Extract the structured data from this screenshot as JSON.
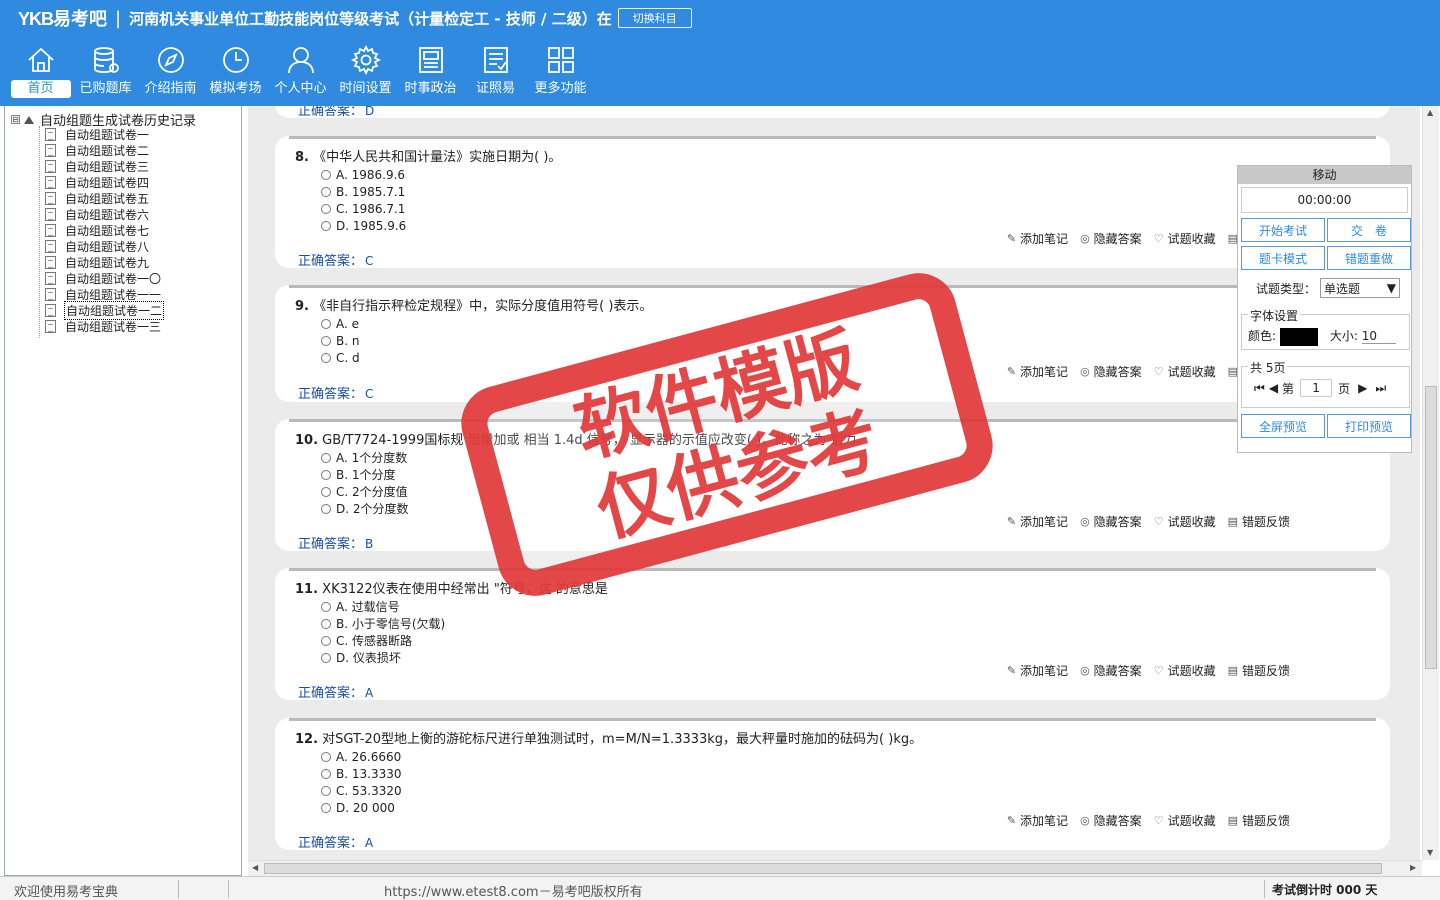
{
  "header": {
    "logo_prefix": "YKB",
    "logo_suffix": "易考吧",
    "separator": "|",
    "exam_title": "河南机关事业单位工勤技能岗位等级考试（计量检定工 - 技师 / 二级）在",
    "switch_label": "切换科目"
  },
  "nav": [
    {
      "label": "首页",
      "icon": "home-icon"
    },
    {
      "label": "已购题库",
      "icon": "database-icon"
    },
    {
      "label": "介绍指南",
      "icon": "compass-icon"
    },
    {
      "label": "模拟考场",
      "icon": "clock-icon"
    },
    {
      "label": "个人中心",
      "icon": "user-icon"
    },
    {
      "label": "时间设置",
      "icon": "gear-icon"
    },
    {
      "label": "时事政治",
      "icon": "newspaper-icon"
    },
    {
      "label": "证照易",
      "icon": "certificate-icon"
    },
    {
      "label": "更多功能",
      "icon": "grid-icon"
    }
  ],
  "tree": {
    "toggle": "⊟",
    "root": "自动组题生成试卷历史记录",
    "items": [
      "自动组题试卷一",
      "自动组题试卷二",
      "自动组题试卷三",
      "自动组题试卷四",
      "自动组题试卷五",
      "自动组题试卷六",
      "自动组题试卷七",
      "自动组题试卷八",
      "自动组题试卷九",
      "自动组题试卷一〇",
      "自动组题试卷一一",
      "自动组题试卷一二",
      "自动组题试卷一三"
    ]
  },
  "labels": {
    "answer_label": "正确答案：",
    "add_note": "添加笔记",
    "hide_answer": "隐藏答案",
    "favorite": "试题收藏",
    "report_error": "错题反馈"
  },
  "prev_answer": "D",
  "questions": [
    {
      "num": "8.",
      "text": "《中华人民共和国计量法》实施日期为( )。",
      "options": [
        "A. 1986.9.6",
        "B. 1985.7.1",
        "C. 1986.7.1",
        "D. 1985.9.6"
      ],
      "answer": "C"
    },
    {
      "num": "9.",
      "text": "《非自行指示秤检定规程》中，实际分度值用符号( )表示。",
      "options": [
        "A. e",
        "B. n",
        "C. d"
      ],
      "answer": "C"
    },
    {
      "num": "10.",
      "text": "GB/T7724-1999国标规    当增加或          相当    1.4d    信号，    显示器的示值应改变( )，此称之为    别力。",
      "options": [
        "A. 1个分度数",
        "B. 1个分度",
        "C. 2个分度值",
        "D. 2个分度数"
      ],
      "answer": "B"
    },
    {
      "num": "11.",
      "text": "XK3122仪表在使用中经常出    \"符号，这    的意思是",
      "options": [
        "A. 过载信号",
        "B. 小于零信号(欠载)",
        "C. 传感器断路",
        "D. 仪表损坏"
      ],
      "answer": "A"
    },
    {
      "num": "12.",
      "text": "对SGT-20型地上衡的游砣标尺进行单独测试时，m=M/N=1.3333kg，最大秤量时施加的砝码为( )kg。",
      "options": [
        "A. 26.6660",
        "B. 13.3330",
        "C. 53.3320",
        "D. 20 000"
      ],
      "answer": "A"
    }
  ],
  "panel": {
    "header": "移动",
    "timer": "00:00:00",
    "start_exam": "开始考试",
    "submit": "交　卷",
    "card_mode": "题卡模式",
    "redo_wrong": "错题重做",
    "type_label": "试题类型：",
    "type_value": "单选题",
    "font_legend": "字体设置",
    "color_label": "颜色:",
    "size_label": "大小:",
    "size_value": "10",
    "pages_legend": "共 5页",
    "page_prefix": "第",
    "page_value": "1",
    "page_suffix": "页",
    "fullscreen": "全屏预览",
    "print": "打印预览"
  },
  "stamp": {
    "line1": "软件模版",
    "line2": "仅供参考"
  },
  "status": {
    "welcome": "欢迎使用易考宝典",
    "copyright": "https://www.etest8.com－易考吧版权所有",
    "countdown": "考试倒计时 000 天"
  },
  "colors": {
    "header_bg": "#2f8ae0",
    "stamp": "#e23a3a",
    "answer": "#1a4fa0"
  }
}
